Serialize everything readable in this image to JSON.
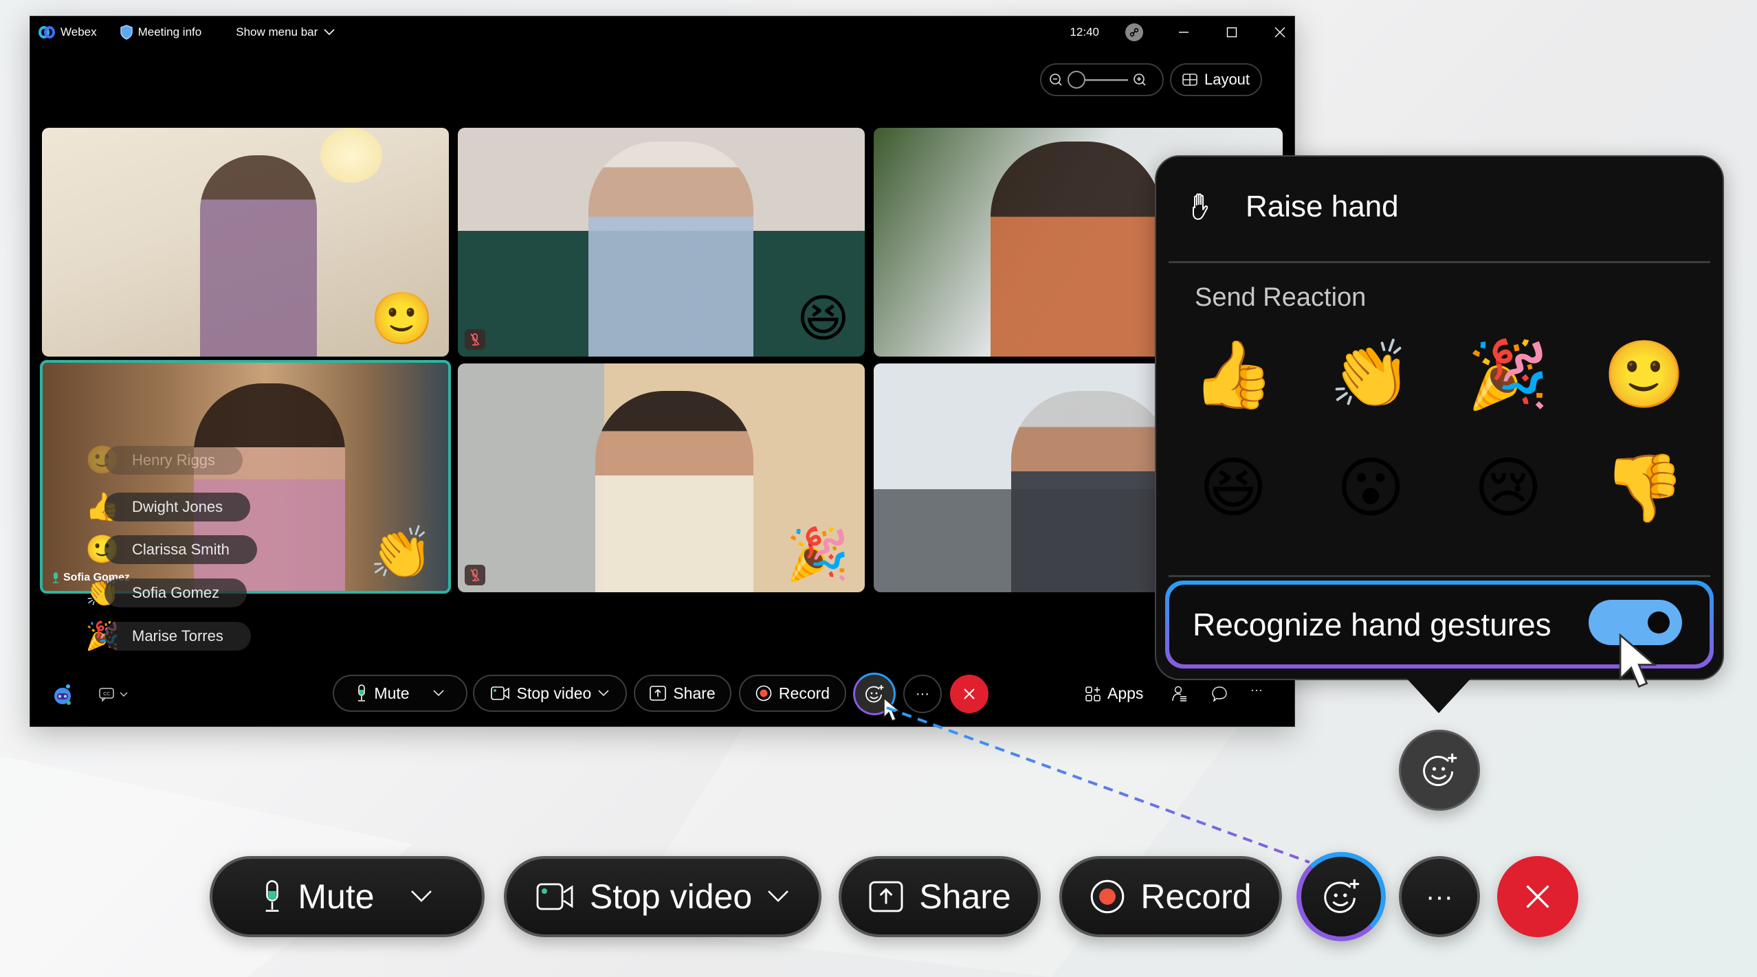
{
  "titlebar": {
    "app_name": "Webex",
    "meeting_info": "Meeting info",
    "show_menu_bar": "Show menu bar",
    "time": "12:40"
  },
  "view_controls": {
    "zoom_level_percent": 0,
    "layout_label": "Layout"
  },
  "tiles": [
    {
      "participant": "",
      "reaction": "🙂",
      "muted": false
    },
    {
      "participant": "",
      "reaction": "😆",
      "muted": true
    },
    {
      "participant": "",
      "reaction": "",
      "muted": false
    },
    {
      "participant": "Sofia Gomez",
      "reaction": "👏",
      "muted": false,
      "active_speaker": true
    },
    {
      "participant": "",
      "reaction": "🎉",
      "muted": true
    },
    {
      "participant": "",
      "reaction": "",
      "muted": false
    }
  ],
  "reaction_feed": [
    {
      "emoji": "🙂",
      "name": "Henry Riggs"
    },
    {
      "emoji": "👍",
      "name": "Dwight Jones"
    },
    {
      "emoji": "🙂",
      "name": "Clarissa Smith"
    },
    {
      "emoji": "👏",
      "name": "Sofia Gomez"
    },
    {
      "emoji": "🎉",
      "name": "Marise Torres"
    }
  ],
  "controls": {
    "mute": "Mute",
    "stop_video": "Stop video",
    "share": "Share",
    "record": "Record",
    "more": "···",
    "apps": "Apps",
    "more_right": "···"
  },
  "popup": {
    "raise_hand": "Raise hand",
    "send_reaction": "Send Reaction",
    "reactions": [
      "👍",
      "👏",
      "🎉",
      "🙂",
      "😆",
      "😮",
      "😢",
      "👎"
    ],
    "reaction_names": [
      "thumbs-up",
      "clap",
      "celebrate",
      "smile",
      "laugh",
      "surprised",
      "sad",
      "thumbs-down"
    ],
    "gesture_label": "Recognize hand gestures",
    "gesture_enabled": true
  },
  "big_controls": {
    "mute": "Mute",
    "stop_video": "Stop video",
    "share": "Share",
    "record": "Record",
    "more": "···"
  },
  "colors": {
    "accent_blue": "#2a9df4",
    "accent_purple": "#8a5ae0",
    "end_red": "#e0202f",
    "mic_green": "#3cc29a",
    "toggle_blue": "#64b0f5",
    "record_red": "#f0523e"
  }
}
